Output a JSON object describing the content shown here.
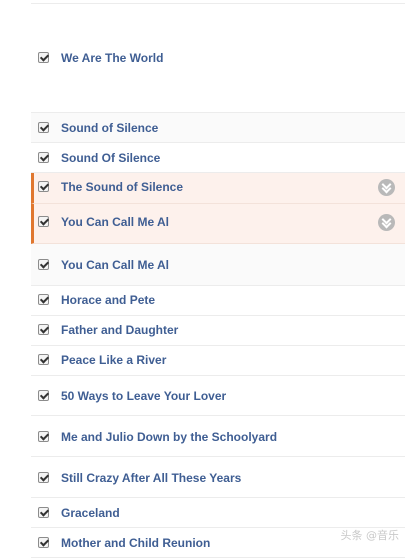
{
  "songs": [
    {
      "title": "We Are The World",
      "checked": true
    },
    {
      "title": "Sound of Silence",
      "checked": true
    },
    {
      "title": "Sound Of Silence",
      "checked": true
    },
    {
      "title": "The Sound of Silence",
      "checked": true,
      "selected": true,
      "icon": "chevron-down-icon"
    },
    {
      "title": "You Can Call Me Al",
      "checked": true,
      "selected": true,
      "icon": "chevron-down-icon"
    },
    {
      "title": "You Can Call Me Al",
      "checked": true
    },
    {
      "title": "Horace and Pete",
      "checked": true
    },
    {
      "title": "Father and Daughter",
      "checked": true
    },
    {
      "title": "Peace Like a River",
      "checked": true
    },
    {
      "title": "50 Ways to Leave Your Lover",
      "checked": true
    },
    {
      "title": "Me and Julio Down by the Schoolyard",
      "checked": true
    },
    {
      "title": "Still Crazy After All These Years",
      "checked": true
    },
    {
      "title": "Graceland",
      "checked": true
    },
    {
      "title": "Mother and Child Reunion",
      "checked": true
    }
  ],
  "accent_color": "#e0772f",
  "link_color": "#3f5e93",
  "watermark": "头条 @音乐"
}
